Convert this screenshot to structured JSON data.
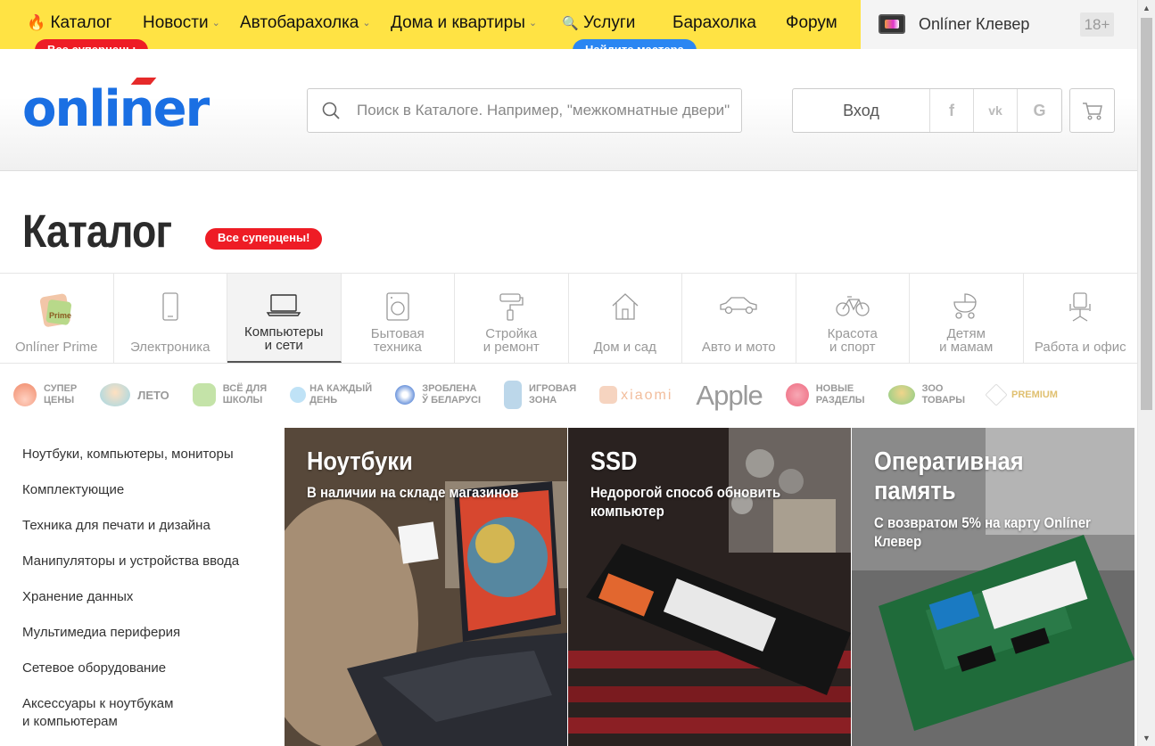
{
  "topnav": {
    "items": [
      {
        "label": "Каталог",
        "icon": "fire-icon"
      },
      {
        "label": "Новости",
        "dropdown": true
      },
      {
        "label": "Автобарахолка",
        "dropdown": true
      },
      {
        "label": "Дома и квартиры",
        "dropdown": true
      },
      {
        "label": "Услуги",
        "icon": "search-icon"
      },
      {
        "label": "Барахолка"
      },
      {
        "label": "Форум"
      }
    ],
    "catalog_badge": "Все суперцены",
    "services_badge": "Найдите мастера",
    "clever_label": "Onlíner Клевер",
    "age_label": "18+"
  },
  "header": {
    "logo": "onliner",
    "search_placeholder": "Поиск в Каталоге. Например, \"межкомнатные двери\"",
    "login_label": "Вход",
    "social": [
      "f",
      "vk",
      "G"
    ]
  },
  "page": {
    "title": "Каталог",
    "title_badge": "Все суперцены!"
  },
  "categories": [
    {
      "label": "Onlíner Prime",
      "icon": "prime-icon"
    },
    {
      "label": "Электроника",
      "icon": "phone-icon"
    },
    {
      "label": "Компьютеры\nи сети",
      "icon": "laptop-icon",
      "active": true
    },
    {
      "label": "Бытовая\nтехника",
      "icon": "washer-icon"
    },
    {
      "label": "Стройка\nи ремонт",
      "icon": "paint-roller-icon"
    },
    {
      "label": "Дом и сад",
      "icon": "house-icon"
    },
    {
      "label": "Авто и мото",
      "icon": "car-icon"
    },
    {
      "label": "Красота\nи спорт",
      "icon": "bicycle-icon"
    },
    {
      "label": "Детям\nи мамам",
      "icon": "stroller-icon"
    },
    {
      "label": "Работа и офис",
      "icon": "office-chair-icon"
    }
  ],
  "promos": [
    {
      "label": "Супер\nцены",
      "color": "#f08a6a"
    },
    {
      "label": "Лето",
      "color": "#e8b48a"
    },
    {
      "label": "Всё для\nшколы",
      "color": "#9ccf78"
    },
    {
      "label": "На каждый\nдень",
      "color": "#5fb3e6"
    },
    {
      "label": "Зроблена\nў Беларусі",
      "color": "#5a87d6"
    },
    {
      "label": "Игровая\nзона",
      "color": "#8ab8d8"
    },
    {
      "label": "xiaomi",
      "color": "#f2bd9c"
    },
    {
      "label": "Apple",
      "color": "#9a9a9a"
    },
    {
      "label": "Новые\nразделы",
      "color": "#ee7a8a"
    },
    {
      "label": "Зоо\nтовары",
      "color": "#8ccf88"
    },
    {
      "label": "Premium",
      "color": "#e0c070"
    }
  ],
  "sidemenu": [
    "Ноутбуки, компьютеры, мониторы",
    "Комплектующие",
    "Техника для печати и дизайна",
    "Манипуляторы и устройства ввода",
    "Хранение данных",
    "Мультимедиа периферия",
    "Сетевое оборудование",
    "Аксессуары к ноутбукам\nи компьютерам"
  ],
  "cards": [
    {
      "title": "Ноутбуки",
      "subtitle": "В наличии на складе магазинов"
    },
    {
      "title": "SSD",
      "subtitle": "Недорогой способ обновить компьютер"
    },
    {
      "title": "Оперативная память",
      "subtitle": "С возвратом 5% на карту Onlíner Клевер"
    }
  ]
}
